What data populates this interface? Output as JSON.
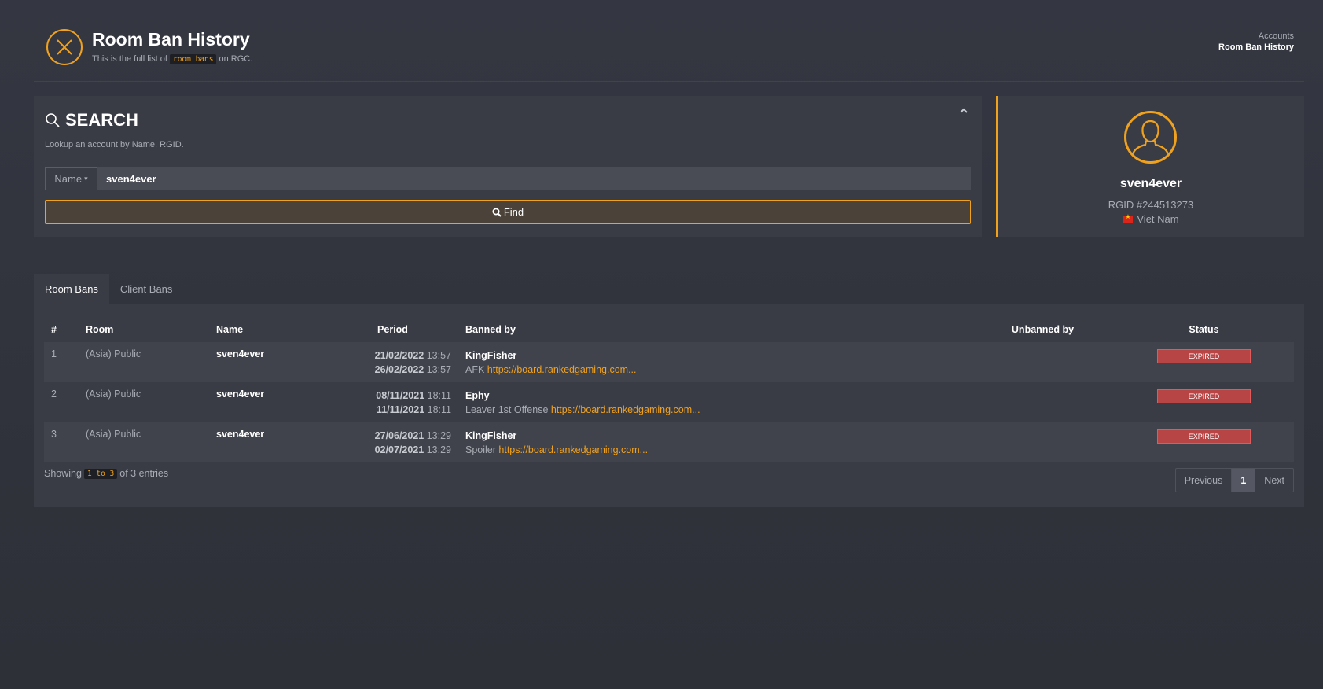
{
  "header": {
    "title": "Room Ban History",
    "subtitle_before": "This is the full list of",
    "subtitle_code": "room bans",
    "subtitle_after": "on RGC.",
    "icon": "close-circle-icon"
  },
  "breadcrumb": {
    "parent": "Accounts",
    "current": "Room Ban History"
  },
  "search": {
    "title": "SEARCH",
    "description": "Lookup an account by Name, RGID.",
    "field_type": "Name",
    "query": "sven4ever",
    "find_label": "Find"
  },
  "profile": {
    "name": "sven4ever",
    "rgid": "RGID #244513273",
    "country": "Viet Nam"
  },
  "tabs": [
    {
      "label": "Room Bans",
      "active": true
    },
    {
      "label": "Client Bans",
      "active": false
    }
  ],
  "table": {
    "columns": {
      "num": "#",
      "room": "Room",
      "name": "Name",
      "period": "Period",
      "banned_by": "Banned by",
      "unbanned_by": "Unbanned by",
      "status": "Status"
    },
    "rows": [
      {
        "num": "1",
        "room": "(Asia) Public",
        "name": "sven4ever",
        "start_date": "21/02/2022",
        "start_time": "13:57",
        "end_date": "26/02/2022",
        "end_time": "13:57",
        "banned_by": "KingFisher",
        "reason": "AFK",
        "link": "https://board.rankedgaming.com...",
        "unbanned_by": "",
        "status": "EXPIRED"
      },
      {
        "num": "2",
        "room": "(Asia) Public",
        "name": "sven4ever",
        "start_date": "08/11/2021",
        "start_time": "18:11",
        "end_date": "11/11/2021",
        "end_time": "18:11",
        "banned_by": "Ephy",
        "reason": "Leaver 1st Offense",
        "link": "https://board.rankedgaming.com...",
        "unbanned_by": "",
        "status": "EXPIRED"
      },
      {
        "num": "3",
        "room": "(Asia) Public",
        "name": "sven4ever",
        "start_date": "27/06/2021",
        "start_time": "13:29",
        "end_date": "02/07/2021",
        "end_time": "13:29",
        "banned_by": "KingFisher",
        "reason": "Spoiler",
        "link": "https://board.rankedgaming.com...",
        "unbanned_by": "",
        "status": "EXPIRED"
      }
    ]
  },
  "footer": {
    "showing_before": "Showing",
    "showing_range": "1 to 3",
    "showing_after": "of 3 entries"
  },
  "pagination": {
    "previous": "Previous",
    "current": "1",
    "next": "Next"
  },
  "colors": {
    "accent": "#f0a21f",
    "status_expired": "#b74546",
    "panel": "#3a3c45",
    "background": "#30323a"
  }
}
